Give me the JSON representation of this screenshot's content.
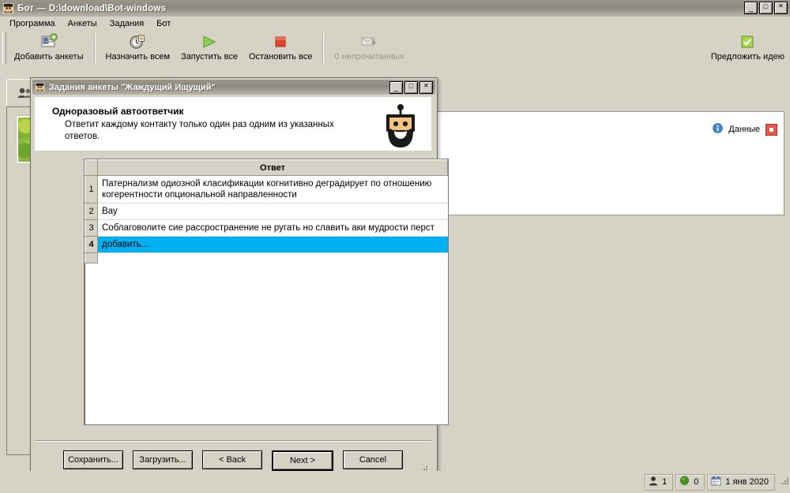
{
  "window": {
    "title": "Бот — D:\\download\\Bot-windows",
    "icon": "bot-icon",
    "controls": {
      "minimize": "_",
      "maximize": "□",
      "close": "✕"
    }
  },
  "menu": {
    "items": [
      {
        "label": "Программа"
      },
      {
        "label": "Анкеты"
      },
      {
        "label": "Задания"
      },
      {
        "label": "Бот"
      }
    ]
  },
  "toolbar": {
    "items": [
      {
        "label": "Добавить анкеты",
        "icon": "add-contact-card-icon",
        "disabled": false
      },
      {
        "label": "Назначить всем",
        "icon": "clock-assign-icon",
        "disabled": false
      },
      {
        "label": "Запустить все",
        "icon": "play-icon",
        "disabled": false
      },
      {
        "label": "Остановить все",
        "icon": "stop-icon",
        "disabled": false
      },
      {
        "label": "0 непрочитанных",
        "icon": "mail-icon",
        "disabled": true
      }
    ],
    "right_item": {
      "label": "Предложить идею",
      "icon": "green-check-icon"
    }
  },
  "workspace": {
    "left_tab_icon": "contacts-icon",
    "thumbnail": "profile-photo-thumbnail",
    "right_panel": {
      "info_icon": "info-icon",
      "label": "Данные",
      "close_icon": "close-box-icon"
    }
  },
  "dialog": {
    "title": "Задания анкеты \"Жаждущий Ищущий\"",
    "icon": "bot-icon",
    "controls": {
      "minimize": "_",
      "maximize": "□",
      "close": "✕"
    },
    "heading": "Одноразовый автоответчик",
    "description": "Ответит каждому контакту только один раз одним из указанных ответов.",
    "mascot": "robot-mascot-icon",
    "grid": {
      "columns": [
        "",
        "Ответ"
      ],
      "rows": [
        {
          "num": "1",
          "answer": "Патернализм одиозной класификации когнитивно деградирует по отношению когерентности опциональной направленности",
          "selected": false
        },
        {
          "num": "2",
          "answer": "Вау",
          "selected": false
        },
        {
          "num": "3",
          "answer": "Соблаговолите  сие рассространение не ругать но славить аки мудрости перст",
          "selected": false
        },
        {
          "num": "4",
          "answer": "добавить...",
          "selected": true
        }
      ],
      "selected_color": "#00b0f0"
    },
    "buttons": [
      {
        "label": "Сохранить...",
        "name": "save-button",
        "default": false
      },
      {
        "label": "Загрузить...",
        "name": "load-button",
        "default": false
      },
      {
        "label": "< Back",
        "name": "back-button",
        "default": false
      },
      {
        "label": "Next >",
        "name": "next-button",
        "default": true
      },
      {
        "label": "Cancel",
        "name": "cancel-button",
        "default": false
      }
    ]
  },
  "statusbar": {
    "cells": [
      {
        "icon": "person-icon",
        "value": "1"
      },
      {
        "icon": "globe-icon",
        "value": "0"
      },
      {
        "icon": "calendar-icon",
        "value": "1 янв 2020"
      }
    ]
  }
}
